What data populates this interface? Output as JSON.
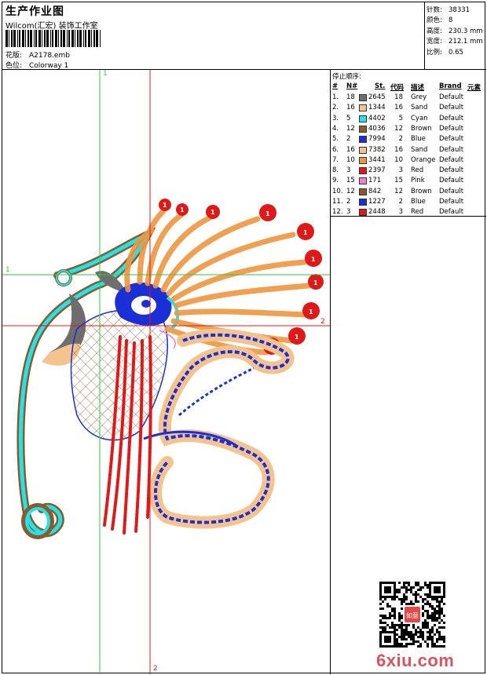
{
  "header": {
    "title": "生产作业图",
    "company": "Wilcom(汇宏) 装饰工作室",
    "design_label": "花版:",
    "design_value": "A2178.emb",
    "colorway_label": "色位:",
    "colorway_value": "Colorway 1"
  },
  "stats": [
    {
      "label": "针数:",
      "value": "38331"
    },
    {
      "label": "颜色:",
      "value": "8"
    },
    {
      "label": "高度:",
      "value": "230.3 mm"
    },
    {
      "label": "宽度:",
      "value": "212.1 mm"
    },
    {
      "label": "比例:",
      "value": "0.65"
    }
  ],
  "stops": {
    "title": "停止顺序:",
    "columns": [
      "#",
      "N#",
      "St.",
      "代码",
      "描述",
      "Brand",
      "元素"
    ],
    "rows": [
      {
        "idx": "1.",
        "n": "18",
        "st": "2645",
        "code": "18",
        "desc": "Grey",
        "brand": "Default",
        "color": "#6e6e6e"
      },
      {
        "idx": "2.",
        "n": "16",
        "st": "1344",
        "code": "16",
        "desc": "Sand",
        "brand": "Default",
        "color": "#f5c48e"
      },
      {
        "idx": "3.",
        "n": "5",
        "st": "4402",
        "code": "5",
        "desc": "Cyan",
        "brand": "Default",
        "color": "#22e2ea"
      },
      {
        "idx": "4.",
        "n": "12",
        "st": "4036",
        "code": "12",
        "desc": "Brown",
        "brand": "Default",
        "color": "#8b5a2b"
      },
      {
        "idx": "5.",
        "n": "2",
        "st": "7994",
        "code": "2",
        "desc": "Blue",
        "brand": "Default",
        "color": "#1a2fd6"
      },
      {
        "idx": "6.",
        "n": "16",
        "st": "7382",
        "code": "16",
        "desc": "Sand",
        "brand": "Default",
        "color": "#f5c48e"
      },
      {
        "idx": "7.",
        "n": "10",
        "st": "3441",
        "code": "10",
        "desc": "Orange",
        "brand": "Default",
        "color": "#f09640"
      },
      {
        "idx": "8.",
        "n": "3",
        "st": "2397",
        "code": "3",
        "desc": "Red",
        "brand": "Default",
        "color": "#e01818"
      },
      {
        "idx": "9.",
        "n": "15",
        "st": "171",
        "code": "15",
        "desc": "Pink",
        "brand": "Default",
        "color": "#ee82d0"
      },
      {
        "idx": "10.",
        "n": "12",
        "st": "842",
        "code": "12",
        "desc": "Brown",
        "brand": "Default",
        "color": "#8b5a2b"
      },
      {
        "idx": "11.",
        "n": "2",
        "st": "1227",
        "code": "2",
        "desc": "Blue",
        "brand": "Default",
        "color": "#1a2fd6"
      },
      {
        "idx": "12.",
        "n": "3",
        "st": "2448",
        "code": "3",
        "desc": "Red",
        "brand": "Default",
        "color": "#e01818"
      }
    ]
  },
  "guides": {
    "v1": "1",
    "h1": "1",
    "h2": "2",
    "v2": "2"
  },
  "watermark": "6xiu.com",
  "qr_stamp_text": "如意"
}
